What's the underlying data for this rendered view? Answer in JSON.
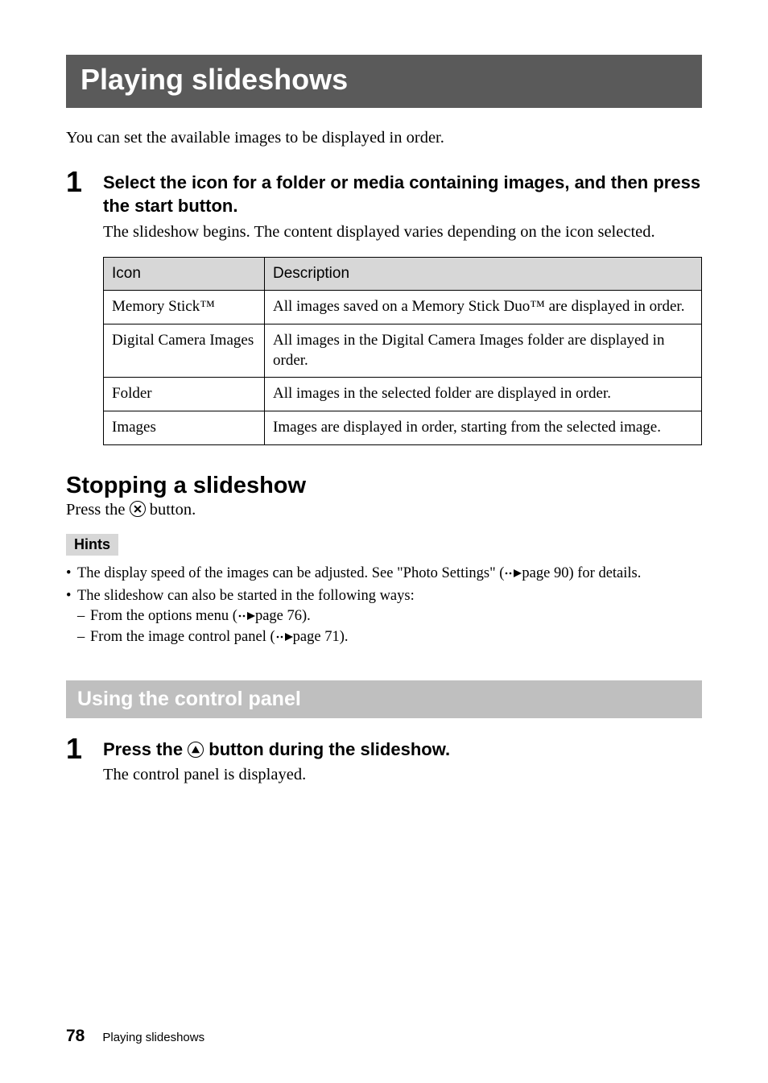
{
  "header": {
    "title": "Playing slideshows"
  },
  "intro": "You can set the available images to be displayed in order.",
  "step1": {
    "num": "1",
    "title": "Select the icon for a folder or media containing images, and then press the start button.",
    "desc": "The slideshow begins. The content displayed varies depending on the icon selected."
  },
  "table": {
    "headers": {
      "col1": "Icon",
      "col2": "Description"
    },
    "rows": [
      {
        "icon": "Memory Stick™",
        "desc": "All images saved on a Memory Stick Duo™ are displayed in order."
      },
      {
        "icon": "Digital Camera Images",
        "desc": "All images in the Digital Camera Images folder are displayed in order."
      },
      {
        "icon": "Folder",
        "desc": "All images in the selected folder are displayed in order."
      },
      {
        "icon": "Images",
        "desc": "Images are displayed in order, starting from the selected image."
      }
    ]
  },
  "stopping": {
    "heading": "Stopping a slideshow",
    "press_pre": "Press the ",
    "press_post": " button."
  },
  "hints": {
    "label": "Hints",
    "items": [
      {
        "pre": "The display speed of the images can be adjusted. See \"Photo Settings\" (",
        "post": "page 90) for details."
      },
      {
        "text": "The slideshow can also be started in the following ways:",
        "sub": [
          {
            "pre": "From the options menu (",
            "post": "page 76)."
          },
          {
            "pre": "From the image control panel (",
            "post": "page 71)."
          }
        ]
      }
    ]
  },
  "section2": {
    "title": "Using the control panel"
  },
  "step2": {
    "num": "1",
    "title_pre": "Press the ",
    "title_post": " button during the slideshow.",
    "desc": "The control panel is displayed."
  },
  "footer": {
    "page": "78",
    "section": "Playing slideshows"
  }
}
